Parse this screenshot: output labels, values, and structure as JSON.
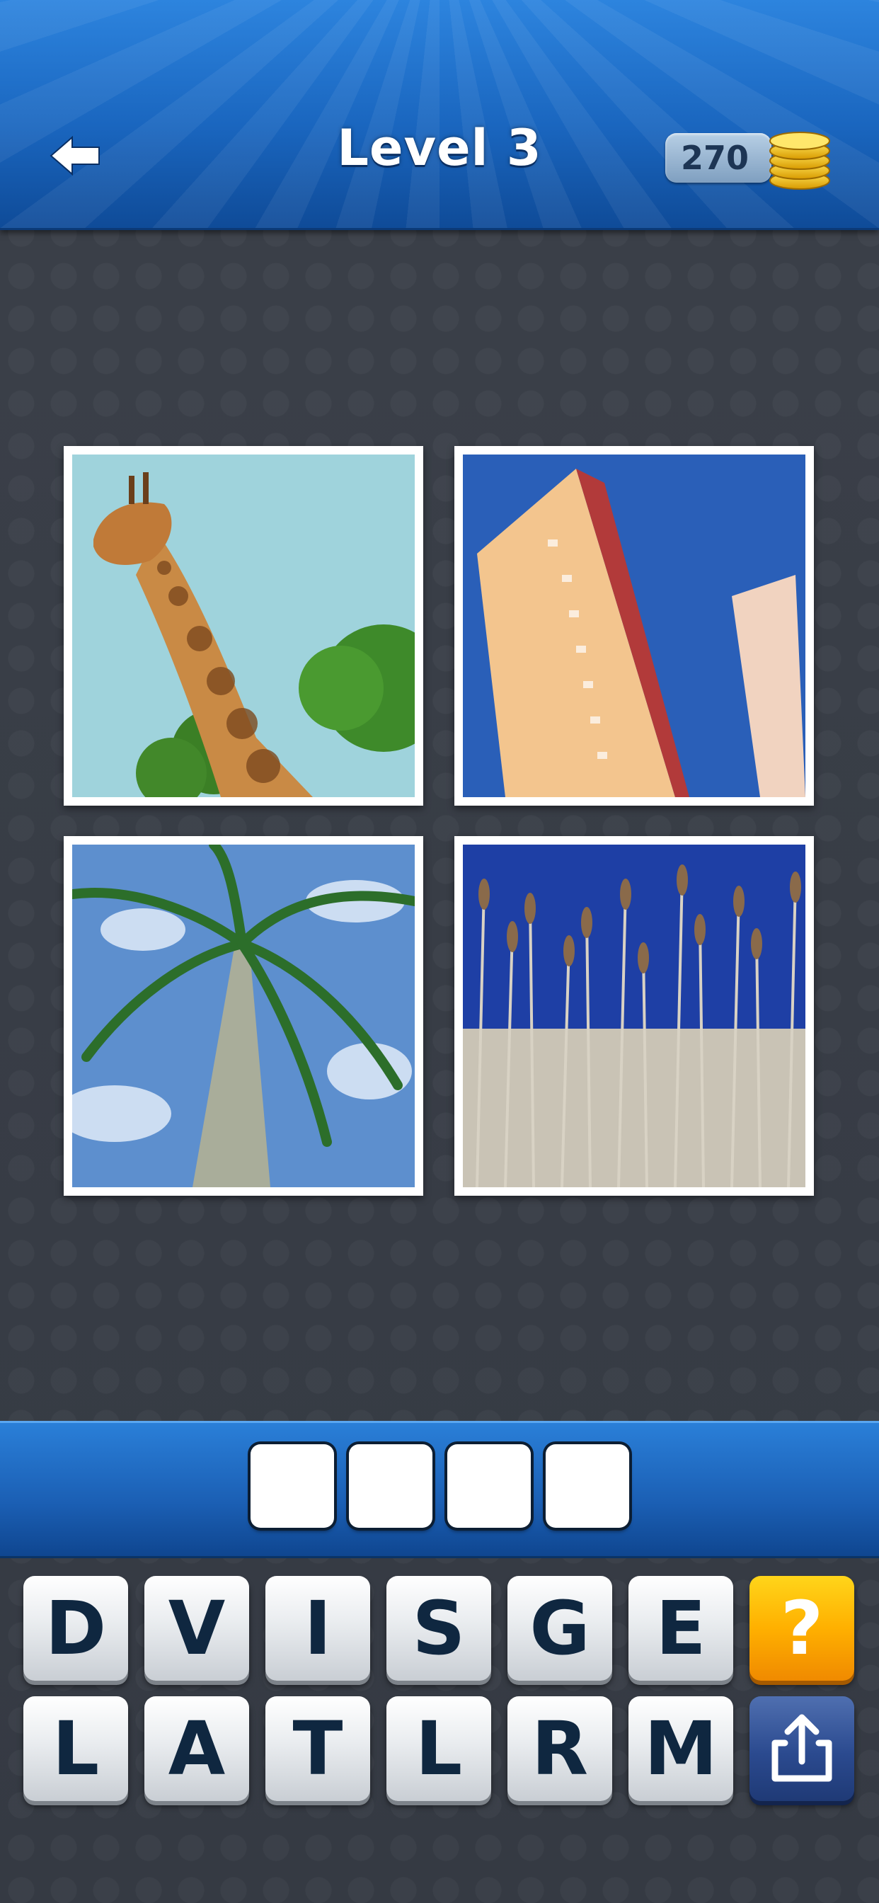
{
  "header": {
    "title": "Level 3",
    "coins": "270",
    "back_icon": "back-arrow-icon",
    "coin_icon": "gold-coins-icon"
  },
  "pictures": [
    {
      "subject": "giraffe"
    },
    {
      "subject": "high-rise building"
    },
    {
      "subject": "palm tree"
    },
    {
      "subject": "tall reeds"
    }
  ],
  "answer": {
    "length": 4,
    "slots": [
      "",
      "",
      "",
      ""
    ]
  },
  "keyboard": {
    "row1": [
      "D",
      "V",
      "I",
      "S",
      "G",
      "E"
    ],
    "row2": [
      "L",
      "A",
      "T",
      "L",
      "R",
      "M"
    ],
    "hint_label": "?",
    "share_icon": "share-icon"
  },
  "colors": {
    "header_blue": "#1a66bf",
    "hint_orange": "#ffb000",
    "share_blue": "#2b4a8f",
    "key_text": "#0f2740"
  }
}
